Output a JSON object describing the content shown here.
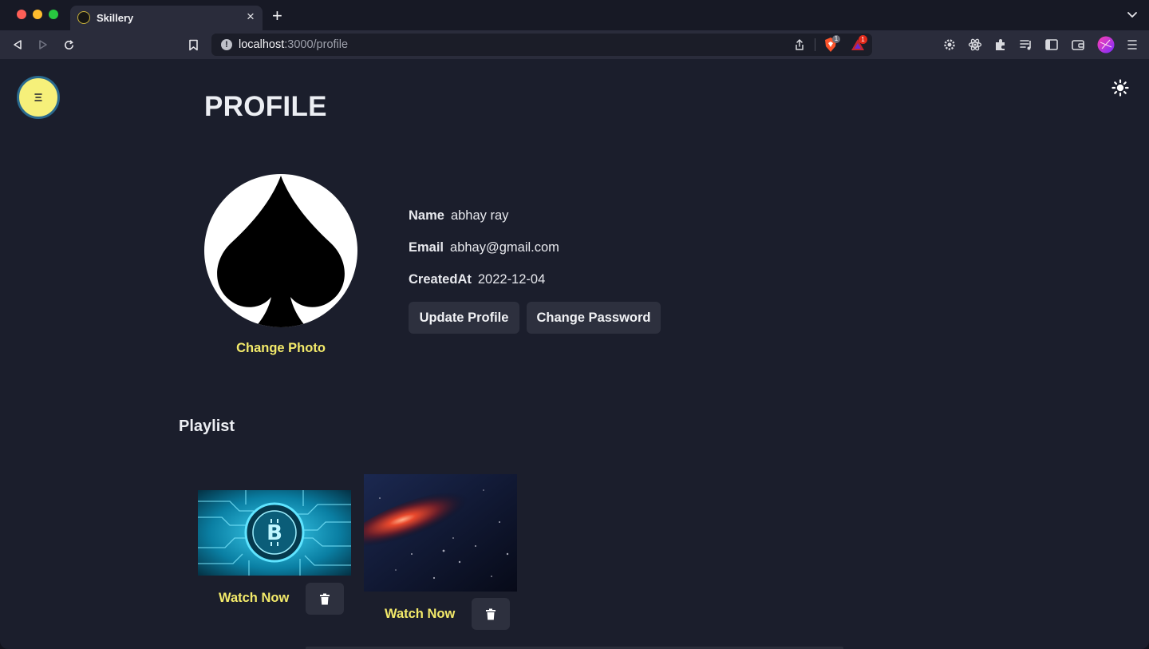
{
  "browser": {
    "tab_title": "Skillery",
    "url_host": "localhost",
    "url_rest": ":3000/profile",
    "new_tab_glyph": "+",
    "close_glyph": "×",
    "brave_shield_count": "1",
    "rewards_count": "1"
  },
  "page": {
    "title": "PROFILE",
    "change_photo": "Change Photo",
    "avatar_icon": "spade-icon"
  },
  "profile": {
    "name_label": "Name",
    "name_value": "abhay ray",
    "email_label": "Email",
    "email_value": "abhay@gmail.com",
    "created_label": "CreatedAt",
    "created_value": "2022-12-04",
    "update_button": "Update Profile",
    "password_button": "Change Password"
  },
  "playlist": {
    "heading": "Playlist",
    "items": [
      {
        "action": "Watch Now",
        "image": "bitcoin-circuit-thumbnail"
      },
      {
        "action": "Watch Now",
        "image": "galaxy-thumbnail"
      }
    ]
  },
  "colors": {
    "page_bg": "#1b1e2c",
    "accent_yellow": "#f3ea6a",
    "button_bg": "#2d303e"
  }
}
